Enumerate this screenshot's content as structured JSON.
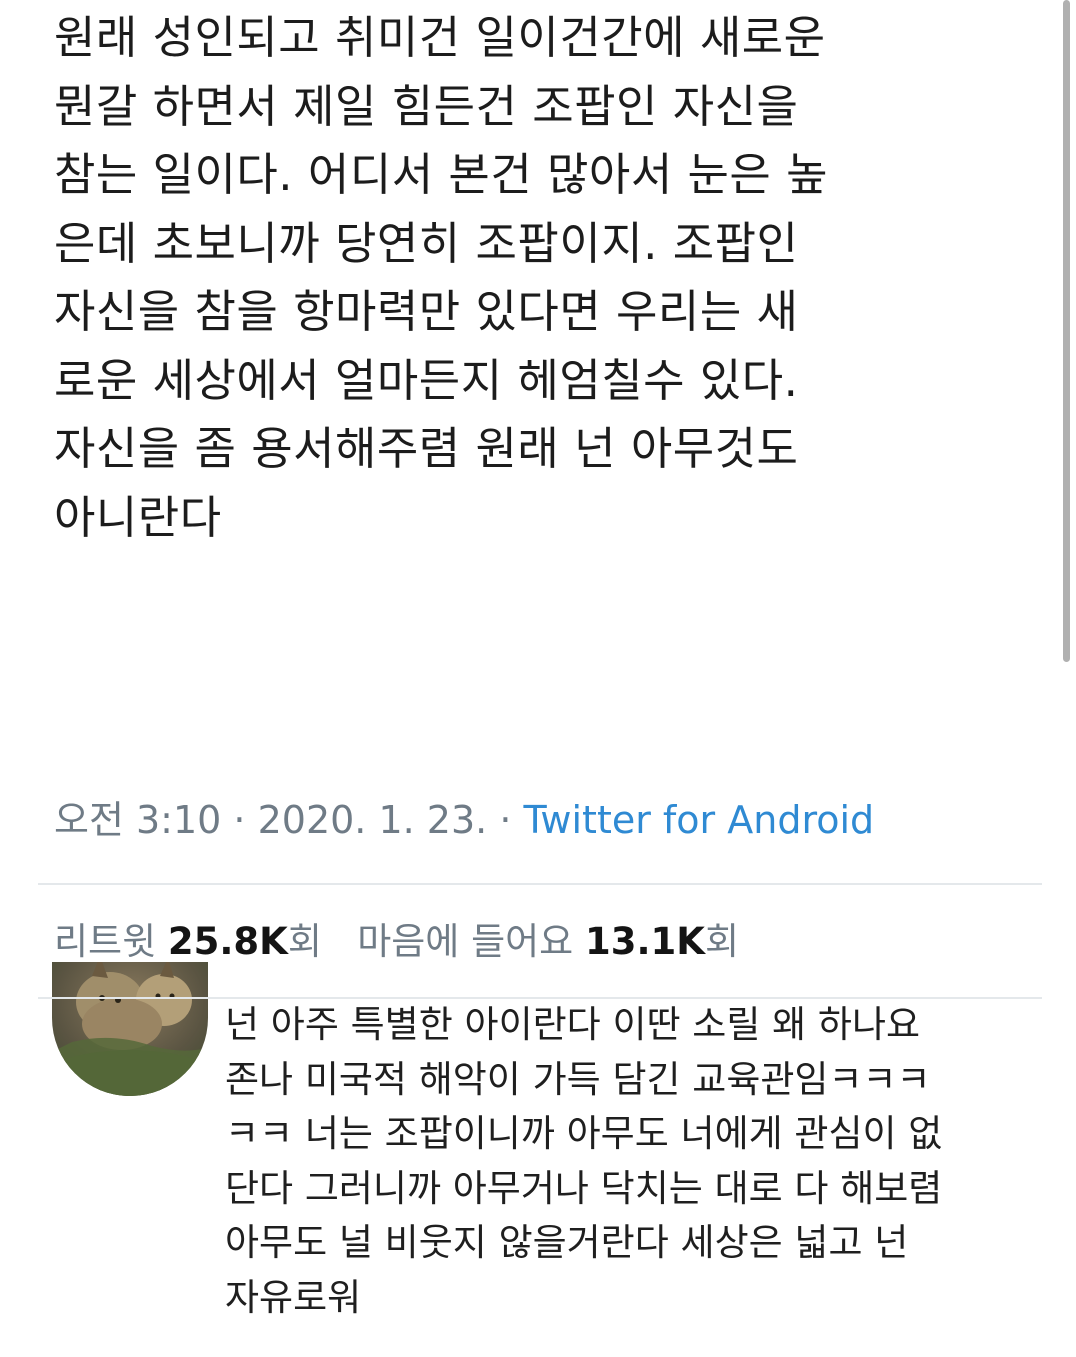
{
  "tweet": {
    "lines": [
      "원래 성인되고 취미건 일이건간에 새로운",
      "뭔갈 하면서 제일 힘든건 조팝인 자신을",
      "참는 일이다. 어디서 본건 많아서 눈은 높",
      "은데 초보니까 당연히 조팝이지. 조팝인",
      "자신을 참을 항마력만 있다면 우리는 새",
      "로운 세상에서 얼마든지 헤엄칠수 있다.",
      "자신을 좀 용서해주렴 원래 넌 아무것도",
      "아니란다"
    ],
    "time": "오전 3:10",
    "separator": " · ",
    "date": "2020. 1. 23.",
    "source": "Twitter for Android"
  },
  "stats": {
    "retweets_label": "리트윗",
    "retweets_count": "25.8K",
    "retweets_suffix": "회",
    "likes_label": "마음에 들어요",
    "likes_count": "13.1K",
    "likes_suffix": "회"
  },
  "reply": {
    "avatar_icon": "lynx-photo-avatar",
    "lines": [
      "넌 아주 특별한 아이란다 이딴 소릴 왜 하나요",
      "존나 미국적 해악이 가득 담긴 교육관임ㅋㅋㅋ",
      "ㅋㅋ 너는 조팝이니까 아무도 너에게 관심이 없",
      "단다 그러니까 아무거나 닥치는 대로 다 해보렴",
      "아무도 널 비웃지 않을거란다 세상은 넓고 넌",
      "자유로워"
    ]
  },
  "colors": {
    "text": "#1c1c1c",
    "muted": "#6f7b86",
    "link": "#2f8ad3",
    "divider": "#e4e8eb"
  }
}
